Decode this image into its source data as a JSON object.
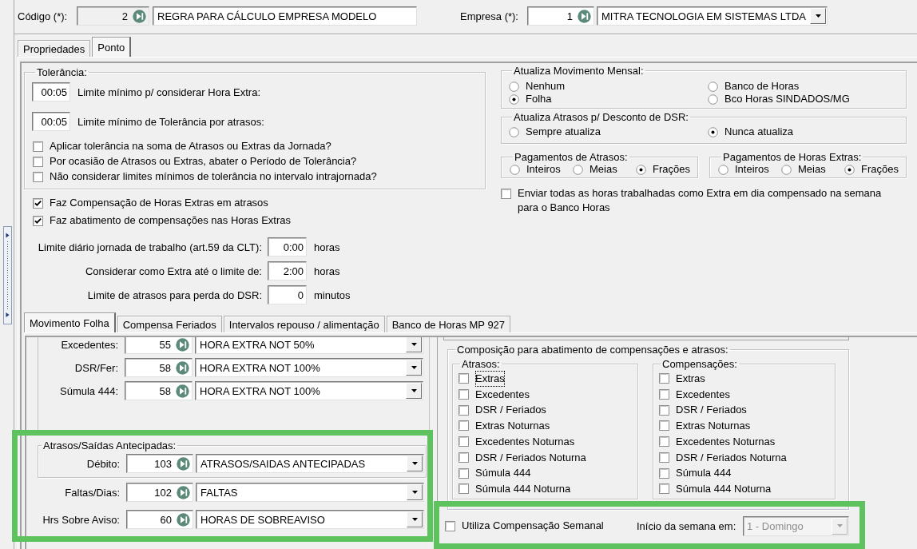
{
  "header": {
    "codigo": {
      "label": "Código (*):",
      "code": "2",
      "readonly": true,
      "name": "REGRA PARA CÁLCULO EMPRESA MODELO"
    },
    "empresa": {
      "label": "Empresa (*):",
      "code": "1",
      "readonly": false,
      "name": "MITRA TECNOLOGIA EM SISTEMAS LTDA"
    }
  },
  "tabs": [
    {
      "label": "Propriedades",
      "selected": false
    },
    {
      "label": "Ponto",
      "selected": true
    }
  ],
  "tolerancia": {
    "title": "Tolerância:",
    "limits": [
      {
        "value": "00:05",
        "label": "Limite mínimo p/ considerar Hora Extra:"
      },
      {
        "value": "00:05",
        "label": "Limite mínimo de Tolerância por atrasos:"
      }
    ],
    "options": [
      {
        "label": "Aplicar tolerância na soma de Atrasos ou Extras da Jornada?",
        "checked": false
      },
      {
        "label": "Por ocasião de Atrasos ou Extras, abater o Período de Tolerância?",
        "checked": false
      },
      {
        "label": "Não considerar limites mínimos de tolerância no intervalo intrajornada?",
        "checked": false
      }
    ]
  },
  "compensacao_options": [
    {
      "label": "Faz Compensação de Horas Extras em atrasos",
      "checked": true
    },
    {
      "label": "Faz abatimento de compensações nas Horas Extras",
      "checked": true
    }
  ],
  "limites": [
    {
      "label": "Limite diário jornada de trabalho (art.59 da CLT):",
      "value": "0:00",
      "unit": "horas"
    },
    {
      "label": "Considerar como Extra até o limite de:",
      "value": "2:00",
      "unit": "horas"
    },
    {
      "label": "Limite de atrasos para perda do DSR:",
      "value": "0",
      "unit": "minutos"
    }
  ],
  "atualiza_movimento_mensal": {
    "title": "Atualiza Movimento Mensal:",
    "options": [
      {
        "label": "Nenhum",
        "selected": false
      },
      {
        "label": "Folha",
        "selected": true
      },
      {
        "label": "Banco de Horas",
        "selected": false
      },
      {
        "label": "Bco Horas SINDADOS/MG",
        "selected": false
      }
    ]
  },
  "atualiza_atrasos_dsr": {
    "title": "Atualiza Atrasos p/ Desconto de DSR:",
    "options": [
      {
        "label": "Sempre atualiza",
        "selected": false
      },
      {
        "label": "Nunca atualiza",
        "selected": true
      }
    ]
  },
  "pagamentos": [
    {
      "title": "Pagamentos de Atrasos:",
      "options": [
        {
          "label": "Inteiros",
          "selected": false
        },
        {
          "label": "Meias",
          "selected": false
        },
        {
          "label": "Frações",
          "selected": true
        }
      ]
    },
    {
      "title": "Pagamentos de Horas Extras:",
      "options": [
        {
          "label": "Inteiros",
          "selected": false
        },
        {
          "label": "Meias",
          "selected": false
        },
        {
          "label": "Frações",
          "selected": true
        }
      ]
    }
  ],
  "enviar_banco_horas": {
    "label": "Enviar todas as horas trabalhadas como Extra em dia compensado na semana para o Banco Horas",
    "checked": false
  },
  "inner_tabs": [
    {
      "label": "Movimento Folha",
      "selected": true
    },
    {
      "label": "Compensa Feriados",
      "selected": false
    },
    {
      "label": "Intervalos repouso / alimentação",
      "selected": false
    },
    {
      "label": "Banco de Horas MP 927",
      "selected": false
    }
  ],
  "movimento_folha": {
    "rows": [
      {
        "label": "Excedentes:",
        "code": "55",
        "name": "HORA EXTRA NOT 50%"
      },
      {
        "label": "DSR/Fer:",
        "code": "58",
        "name": "HORA EXTRA NOT 100%"
      },
      {
        "label": "Súmula 444:",
        "code": "58",
        "name": "HORA EXTRA NOT 100%"
      }
    ],
    "debitos": {
      "highlighted": true,
      "group": {
        "title": "Atrasos/Saídas Antecipadas:",
        "rows": [
          {
            "label": "Débito:",
            "code": "103",
            "name": "ATRASOS/SAIDAS ANTECIPADAS"
          }
        ]
      },
      "rows": [
        {
          "label": "Faltas/Dias:",
          "code": "102",
          "name": "FALTAS"
        },
        {
          "label": "Hrs Sobre Aviso:",
          "code": "60",
          "name": "HORAS DE SOBREAVISO"
        }
      ]
    }
  },
  "composicao": {
    "title": "Composição para abatimento de compensações e atrasos:",
    "groups": [
      {
        "title": "Atrasos:",
        "items": [
          {
            "label": "Extras",
            "checked": false,
            "focused": true
          },
          {
            "label": "Excedentes",
            "checked": false,
            "focused": false
          },
          {
            "label": "DSR / Feriados",
            "checked": false,
            "focused": false
          },
          {
            "label": "Extras Noturnas",
            "checked": false,
            "focused": false
          },
          {
            "label": "Excedentes Noturnas",
            "checked": false,
            "focused": false
          },
          {
            "label": "DSR / Feriados Noturna",
            "checked": false,
            "focused": false
          },
          {
            "label": "Súmula 444",
            "checked": false,
            "focused": false
          },
          {
            "label": "Súmula 444 Noturna",
            "checked": false,
            "focused": false
          }
        ]
      },
      {
        "title": "Compensações:",
        "items": [
          {
            "label": "Extras",
            "checked": false,
            "focused": false
          },
          {
            "label": "Excedentes",
            "checked": false,
            "focused": false
          },
          {
            "label": "DSR / Feriados",
            "checked": false,
            "focused": false
          },
          {
            "label": "Extras Noturnas",
            "checked": false,
            "focused": false
          },
          {
            "label": "Excedentes Noturnas",
            "checked": false,
            "focused": false
          },
          {
            "label": "DSR / Feriados Noturna",
            "checked": false,
            "focused": false
          },
          {
            "label": "Súmula 444",
            "checked": false,
            "focused": false
          },
          {
            "label": "Súmula 444 Noturna",
            "checked": false,
            "focused": false
          }
        ]
      }
    ]
  },
  "compensacao_semanal": {
    "highlighted": true,
    "label": "Utiliza Compensação Semanal",
    "checked": false,
    "inicio_label": "Início da semana em:",
    "inicio_value": "1 - Domingo",
    "disabled": true
  }
}
